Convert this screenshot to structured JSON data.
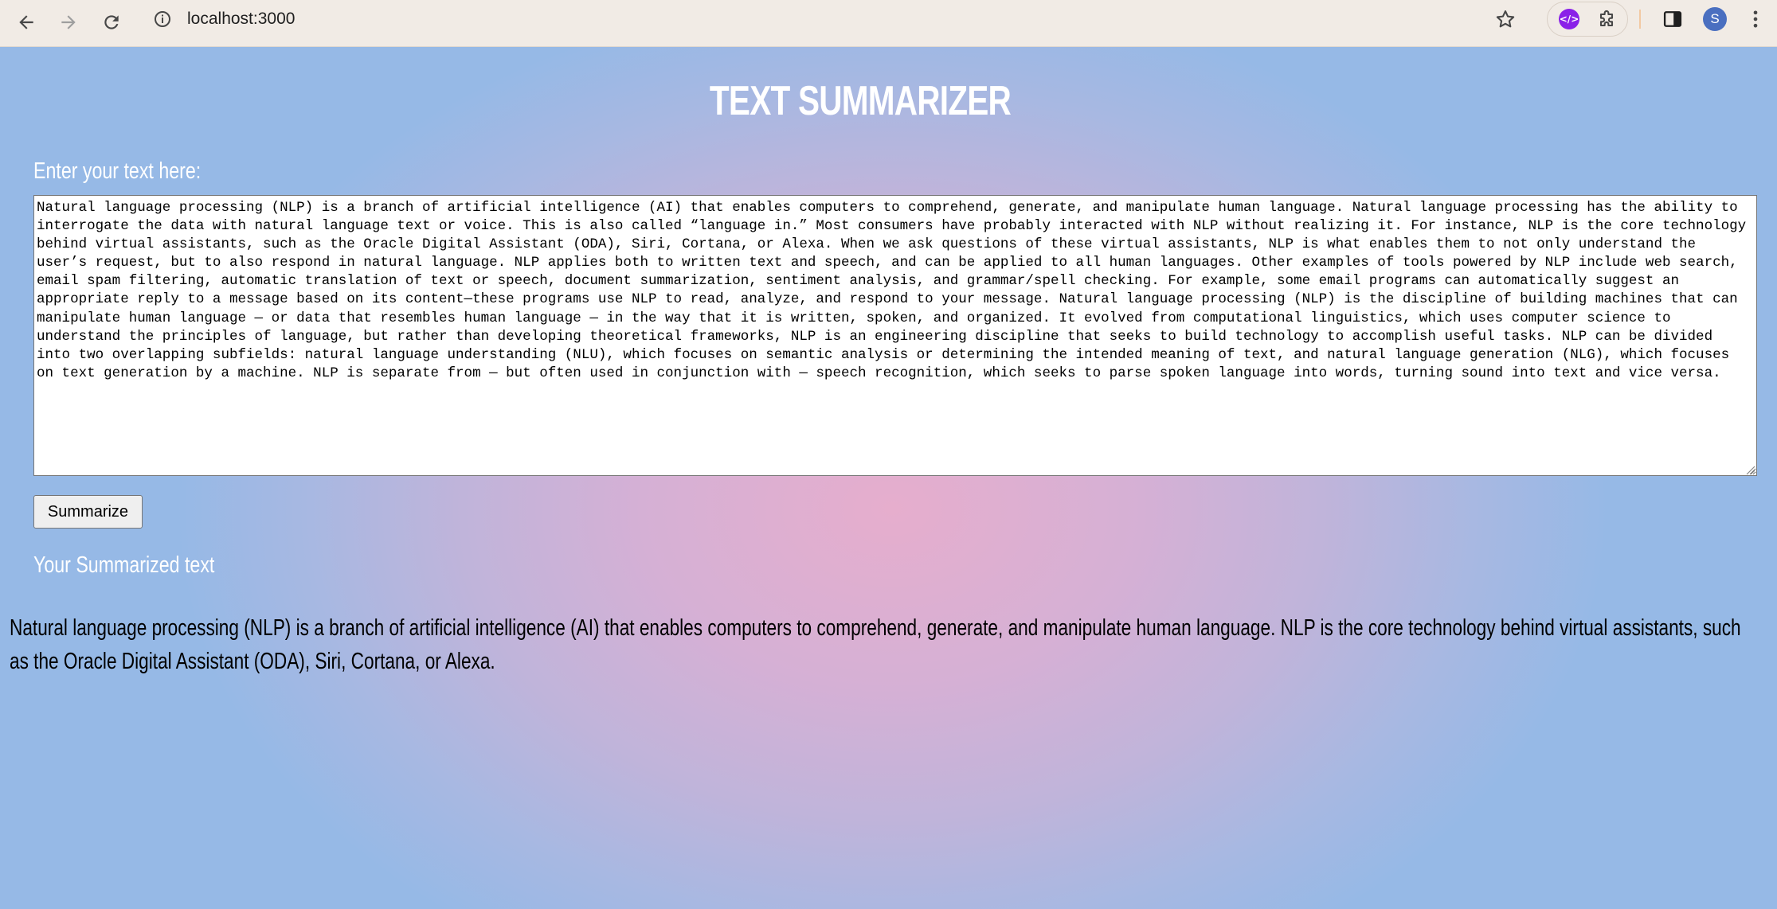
{
  "browser": {
    "url": "localhost:3000",
    "avatar_letter": "S",
    "ext_icon_text": "</>",
    "icons": {
      "back": "back-arrow-icon",
      "forward": "forward-arrow-icon",
      "reload": "reload-icon",
      "site_info": "site-info-icon",
      "bookmark": "star-icon",
      "extension": "ai-extension-icon",
      "extensions": "puzzle-icon",
      "side_panel": "side-panel-icon",
      "menu": "kebab-menu-icon"
    }
  },
  "app": {
    "title": "TEXT SUMMARIZER",
    "input_label": "Enter your text here:",
    "input_value": "Natural language processing (NLP) is a branch of artificial intelligence (AI) that enables computers to comprehend, generate, and manipulate human language. Natural language processing has the ability to interrogate the data with natural language text or voice. This is also called “language in.” Most consumers have probably interacted with NLP without realizing it. For instance, NLP is the core technology behind virtual assistants, such as the Oracle Digital Assistant (ODA), Siri, Cortana, or Alexa. When we ask questions of these virtual assistants, NLP is what enables them to not only understand the user’s request, but to also respond in natural language. NLP applies both to written text and speech, and can be applied to all human languages. Other examples of tools powered by NLP include web search, email spam filtering, automatic translation of text or speech, document summarization, sentiment analysis, and grammar/spell checking. For example, some email programs can automatically suggest an appropriate reply to a message based on its content—these programs use NLP to read, analyze, and respond to your message. Natural language processing (NLP) is the discipline of building machines that can manipulate human language — or data that resembles human language — in the way that it is written, spoken, and organized. It evolved from computational linguistics, which uses computer science to understand the principles of language, but rather than developing theoretical frameworks, NLP is an engineering discipline that seeks to build technology to accomplish useful tasks. NLP can be divided into two overlapping subfields: natural language understanding (NLU), which focuses on semantic analysis or determining the intended meaning of text, and natural language generation (NLG), which focuses on text generation by a machine. NLP is separate from — but often used in conjunction with — speech recognition, which seeks to parse spoken language into words, turning sound into text and vice versa.",
    "button_label": "Summarize",
    "summary_heading": "Your Summarized text",
    "summary_text": "Natural language processing (NLP) is a branch of artificial intelligence (AI) that enables computers to comprehend, generate, and manipulate human language. NLP is the core technology behind virtual assistants, such as the Oracle Digital Assistant (ODA), Siri, Cortana, or Alexa."
  },
  "colors": {
    "gradient_center": "#e6aecd",
    "gradient_edge": "#96b9e6",
    "heading_text": "#ffffff",
    "avatar": "#4a6fc0",
    "extension": "#8a21e8"
  }
}
